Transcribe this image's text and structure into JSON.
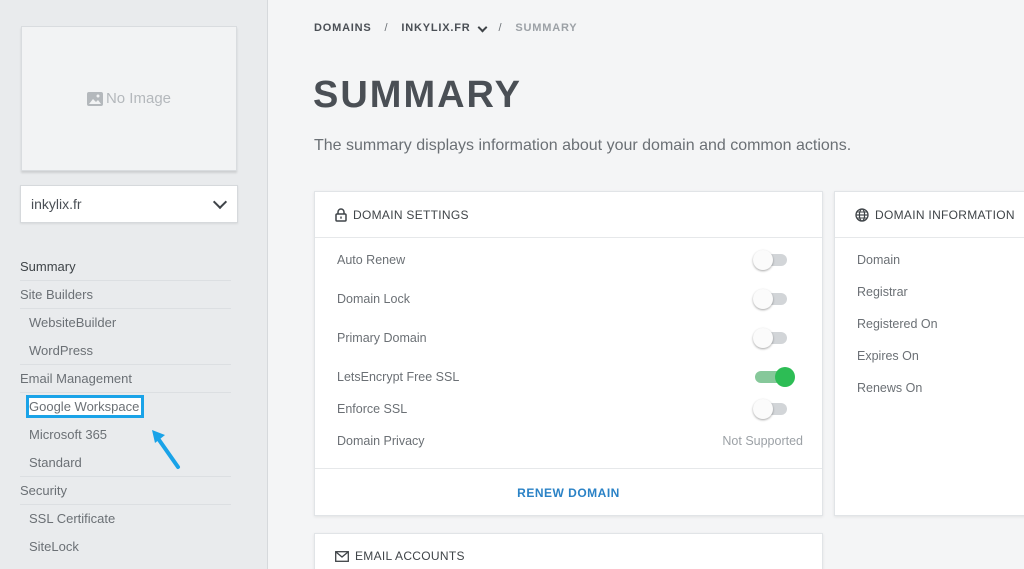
{
  "sidebar": {
    "no_image_label": "No Image",
    "domain_select_value": "inkylix.fr",
    "nav": [
      {
        "type": "section",
        "label": "Summary"
      },
      {
        "type": "section",
        "label": "Site Builders"
      },
      {
        "type": "item",
        "label": "WebsiteBuilder"
      },
      {
        "type": "item",
        "label": "WordPress"
      },
      {
        "type": "section",
        "label": "Email Management"
      },
      {
        "type": "item",
        "label": "Google Workspace"
      },
      {
        "type": "item",
        "label": "Microsoft 365"
      },
      {
        "type": "item",
        "label": "Standard"
      },
      {
        "type": "section",
        "label": "Security"
      },
      {
        "type": "item",
        "label": "SSL Certificate"
      },
      {
        "type": "item",
        "label": "SiteLock"
      }
    ]
  },
  "breadcrumb": {
    "domains": "DOMAINS",
    "sep1": "/",
    "domain": "INKYLIX.FR",
    "sep2": "/",
    "current": "SUMMARY"
  },
  "page": {
    "title": "SUMMARY",
    "subtitle": "The summary displays information about your domain and common actions."
  },
  "domain_settings": {
    "header": "DOMAIN SETTINGS",
    "rows": [
      {
        "label": "Auto Renew",
        "enabled": false
      },
      {
        "label": "Domain Lock",
        "enabled": false
      },
      {
        "label": "Primary Domain",
        "enabled": false
      },
      {
        "label": "LetsEncrypt Free SSL",
        "enabled": true
      },
      {
        "label": "Enforce SSL",
        "enabled": false
      },
      {
        "label": "Domain Privacy",
        "status": "Not Supported"
      }
    ],
    "renew_button": "RENEW DOMAIN"
  },
  "domain_information": {
    "header": "DOMAIN INFORMATION",
    "rows": [
      "Domain",
      "Registrar",
      "Registered On",
      "Expires On",
      "Renews On"
    ]
  },
  "email_accounts": {
    "header": "EMAIL ACCOUNTS"
  },
  "colors": {
    "accent_blue": "#2a82c6",
    "toggle_on": "#2dbd55",
    "highlight_annotation": "#1aa3e8"
  }
}
